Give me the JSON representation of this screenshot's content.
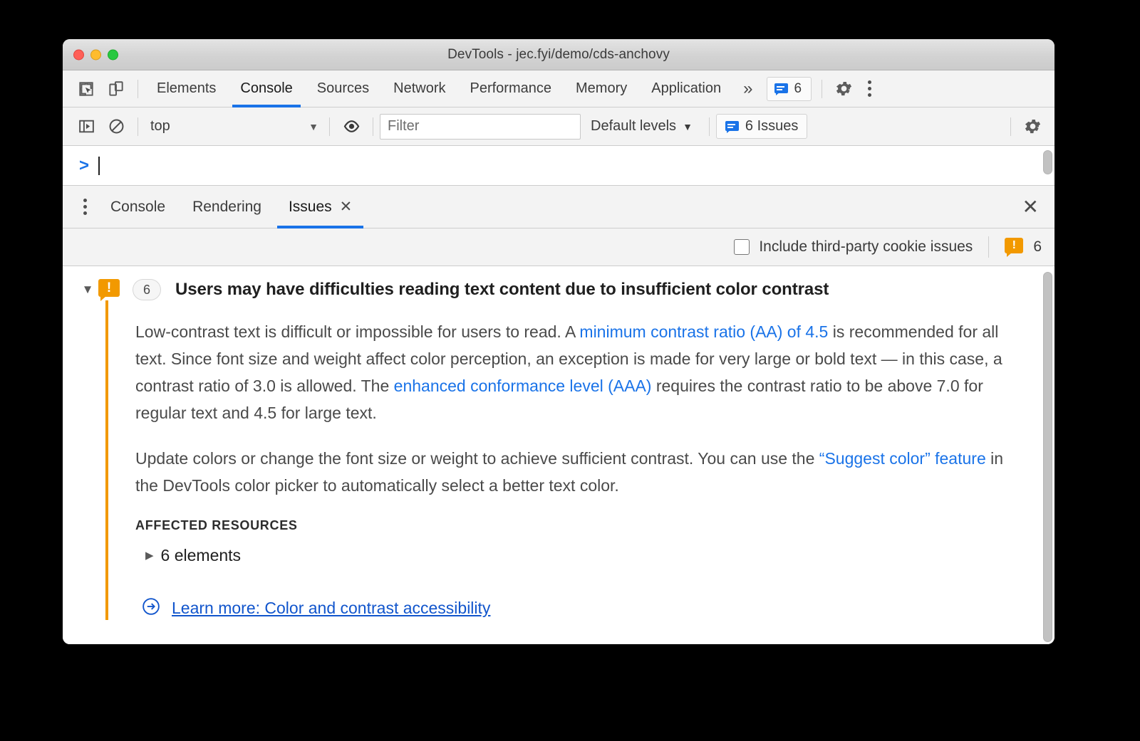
{
  "window": {
    "title": "DevTools - jec.fyi/demo/cds-anchovy",
    "traffic_lights": [
      "close",
      "minimize",
      "zoom"
    ]
  },
  "main_tabbar": {
    "inspect_icon": "inspect-element-icon",
    "device_icon": "device-toolbar-icon",
    "tabs": [
      {
        "label": "Elements",
        "active": false
      },
      {
        "label": "Console",
        "active": true
      },
      {
        "label": "Sources",
        "active": false
      },
      {
        "label": "Network",
        "active": false
      },
      {
        "label": "Performance",
        "active": false
      },
      {
        "label": "Memory",
        "active": false
      },
      {
        "label": "Application",
        "active": false
      }
    ],
    "overflow_label": "»",
    "issues_badge": {
      "icon": "message-bubble-icon",
      "count": "6"
    },
    "settings_icon": "gear-icon",
    "more_icon": "kebab-menu-icon",
    "accent_color": "#1a73e8"
  },
  "console_toolbar": {
    "sidebar_toggle_icon": "console-sidebar-icon",
    "clear_icon": "clear-console-icon",
    "context_value": "top",
    "context_caret": "▼",
    "eye_icon": "live-expression-icon",
    "filter_placeholder": "Filter",
    "filter_value": "",
    "levels_label": "Default levels",
    "levels_caret": "▼",
    "issues_button_label": "6 Issues",
    "issues_button_icon": "message-bubble-icon",
    "settings_icon": "gear-icon"
  },
  "console_prompt": {
    "chevron": "❯",
    "value": ""
  },
  "drawer": {
    "menu_icon": "kebab-menu-icon",
    "tabs": [
      {
        "label": "Console",
        "active": false,
        "closable": false
      },
      {
        "label": "Rendering",
        "active": false,
        "closable": false
      },
      {
        "label": "Issues",
        "active": true,
        "closable": true,
        "close_glyph": "✕"
      }
    ],
    "close_glyph": "✕"
  },
  "issues_toolbar": {
    "checkbox_label": "Include third-party cookie issues",
    "checkbox_checked": false,
    "warning_icon": "warning-bubble-icon",
    "warning_count": "6"
  },
  "issue": {
    "twisty": "▼",
    "warning_icon": "warning-bubble-icon",
    "count": "6",
    "title": "Users may have difficulties reading text content due to insufficient color contrast",
    "paragraph1": {
      "part1": "Low-contrast text is difficult or impossible for users to read. A ",
      "link1": "minimum contrast ratio (AA) of 4.5",
      "part2": " is recommended for all text. Since font size and weight affect color perception, an exception is made for very large or bold text — in this case, a contrast ratio of 3.0 is allowed. The ",
      "link2": "enhanced conformance level (AAA)",
      "part3": " requires the contrast ratio to be above 7.0 for regular text and 4.5 for large text."
    },
    "paragraph2": {
      "part1": "Update colors or change the font size or weight to achieve sufficient contrast. You can use the ",
      "link1": "“Suggest color” feature",
      "part2": " in the DevTools color picker to automatically select a better text color."
    },
    "affected_resources_title": "AFFECTED RESOURCES",
    "affected_resource_twisty": "▶",
    "affected_resource_label": "6 elements",
    "learn_more_icon": "arrow-circle-right-icon",
    "learn_more_label": "Learn more: Color and contrast accessibility",
    "accent_bar_color": "#f29900",
    "link_color": "#1a73e8",
    "learn_more_color": "#1155cc"
  }
}
